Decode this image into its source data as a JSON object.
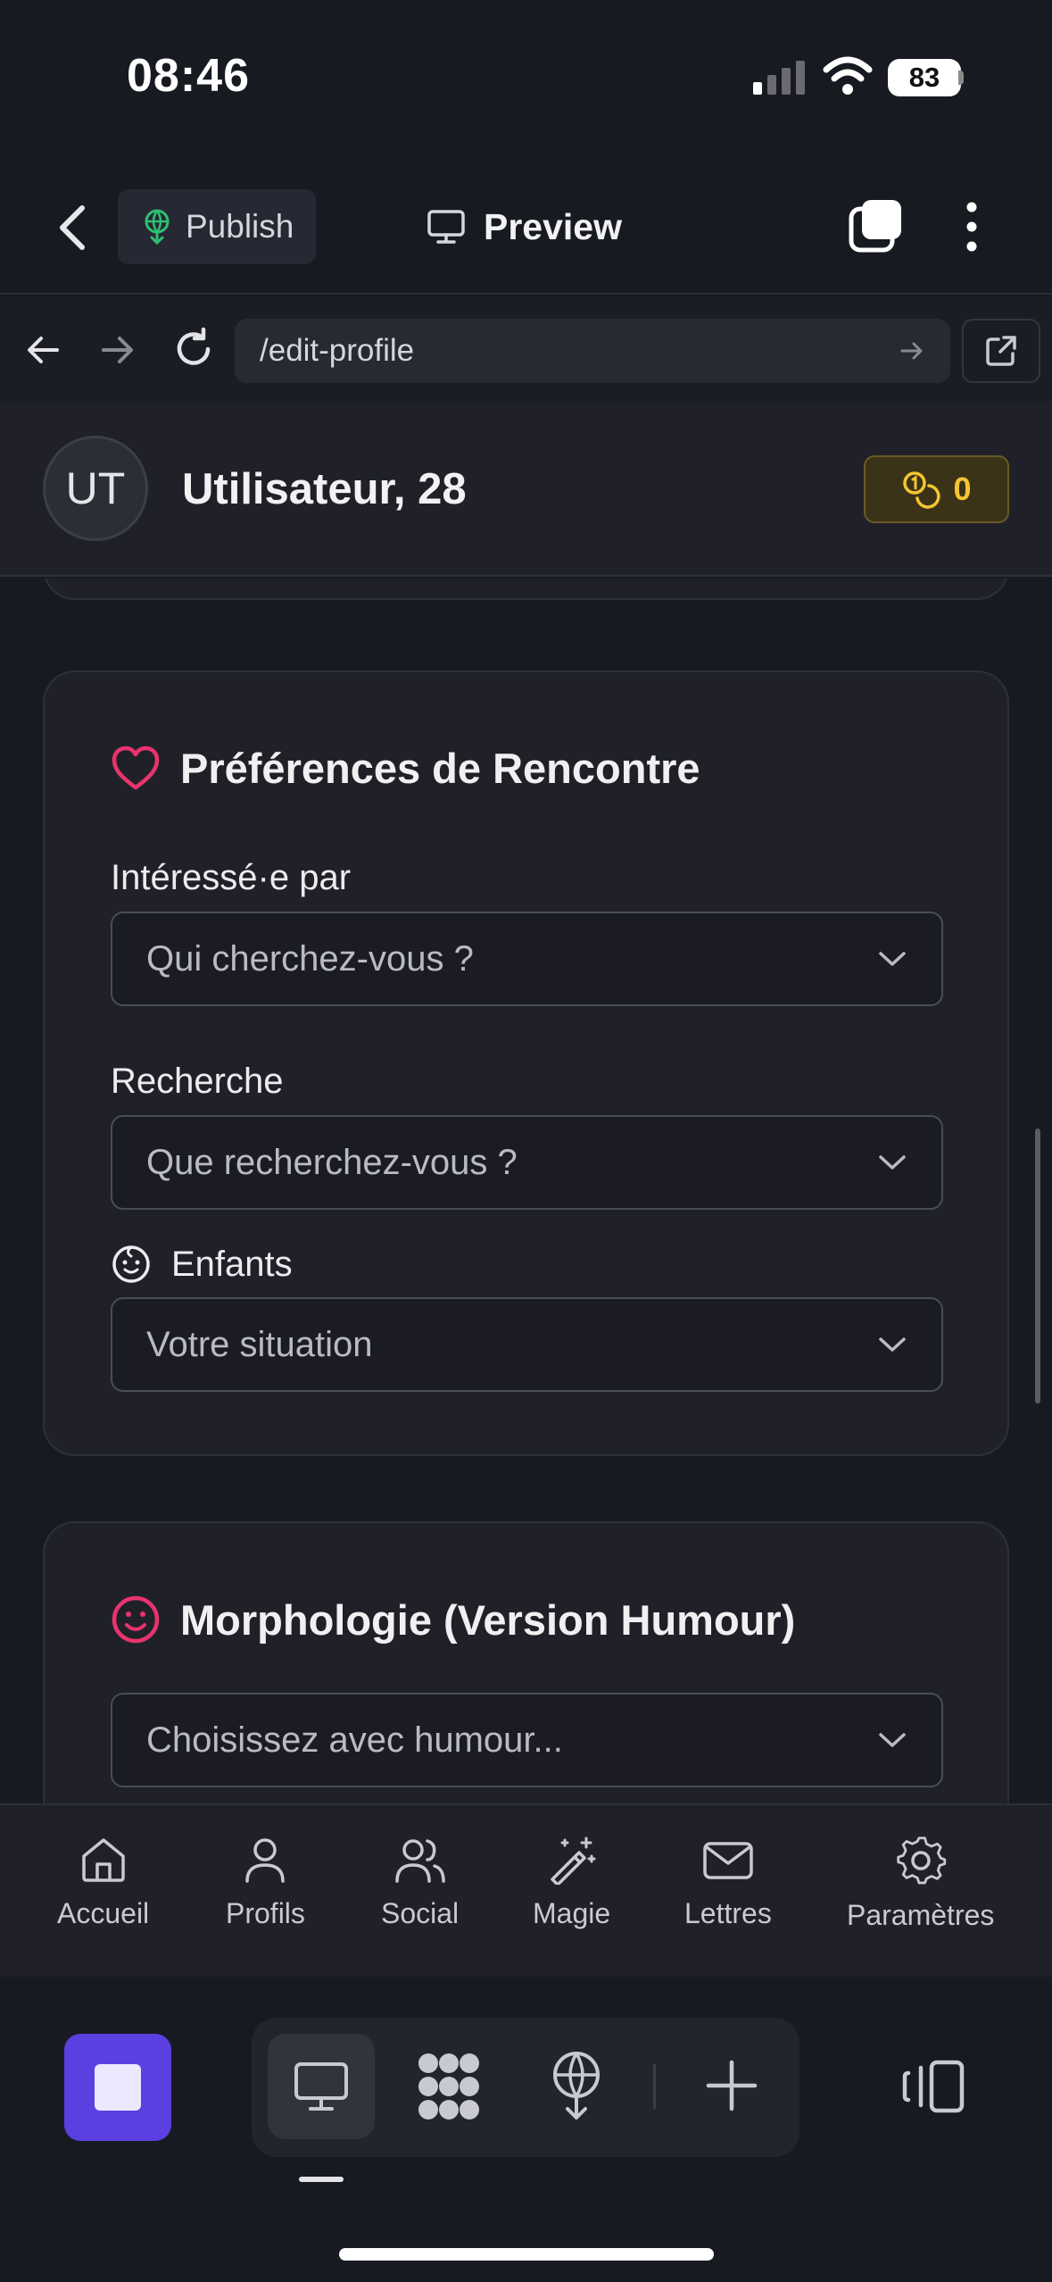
{
  "status_bar": {
    "time": "08:46",
    "battery": "83"
  },
  "toolbar": {
    "publish_label": "Publish",
    "preview_label": "Preview"
  },
  "browser": {
    "url": "/edit-profile"
  },
  "header": {
    "avatar_initials": "UT",
    "user_name": "Utilisateur, 28",
    "coins": "0"
  },
  "preferences_card": {
    "title": "Préférences de Rencontre",
    "interested_label": "Intéressé·e par",
    "interested_placeholder": "Qui cherchez-vous ?",
    "search_label": "Recherche",
    "search_placeholder": "Que recherchez-vous ?",
    "children_label": "Enfants",
    "children_placeholder": "Votre situation"
  },
  "morphology_card": {
    "title": "Morphologie (Version Humour)",
    "placeholder": "Choisissez avec humour..."
  },
  "bottom_nav": {
    "items": [
      {
        "label": "Accueil",
        "icon": "home-icon"
      },
      {
        "label": "Profils",
        "icon": "user-icon"
      },
      {
        "label": "Social",
        "icon": "users-icon"
      },
      {
        "label": "Magie",
        "icon": "magic-wand-icon"
      },
      {
        "label": "Lettres",
        "icon": "mail-icon"
      },
      {
        "label": "Paramètres",
        "icon": "gear-icon"
      }
    ]
  },
  "colors": {
    "accent_pink": "#e8346e",
    "coin_gold": "#f5c531",
    "app_purple": "#5b3fe0",
    "publish_green": "#2fbf71"
  }
}
